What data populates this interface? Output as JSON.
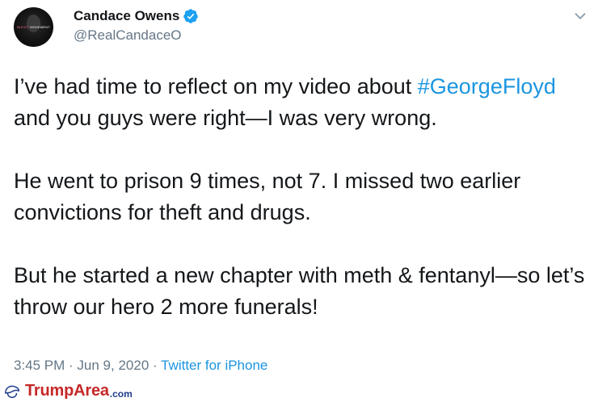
{
  "user": {
    "name": "Candace Owens",
    "handle": "@RealCandaceO",
    "avatar_text_left": "BLEXIT",
    "avatar_text_right": "MOVEMENT"
  },
  "tweet": {
    "p1_before": "I’ve had time to reflect on my video about ",
    "p1_hashtag": "#GeorgeFloyd",
    "p1_after": " and you guys were right—I was very wrong.",
    "p2": "He went to prison 9 times, not 7. I missed two earlier convictions for theft and drugs.",
    "p3": "But he started a new chapter with meth & fentanyl—so let’s throw our hero 2 more funerals!"
  },
  "meta": {
    "time": "3:45 PM",
    "sep1": " · ",
    "date": "Jun 9, 2020",
    "sep2": " · ",
    "source": "Twitter for iPhone"
  },
  "watermark": {
    "brand_main": "TrumpArea",
    "brand_tld": ".com"
  },
  "colors": {
    "link": "#1b95e0",
    "verified": "#1da1f2",
    "secondary_text": "#657786",
    "primary_text": "#14171a",
    "watermark_red": "#c62828",
    "watermark_blue": "#1f3b8c"
  },
  "icons": {
    "verified": "verified-badge-icon",
    "more": "chevron-down-icon",
    "watermark": "trump-hair-icon"
  }
}
